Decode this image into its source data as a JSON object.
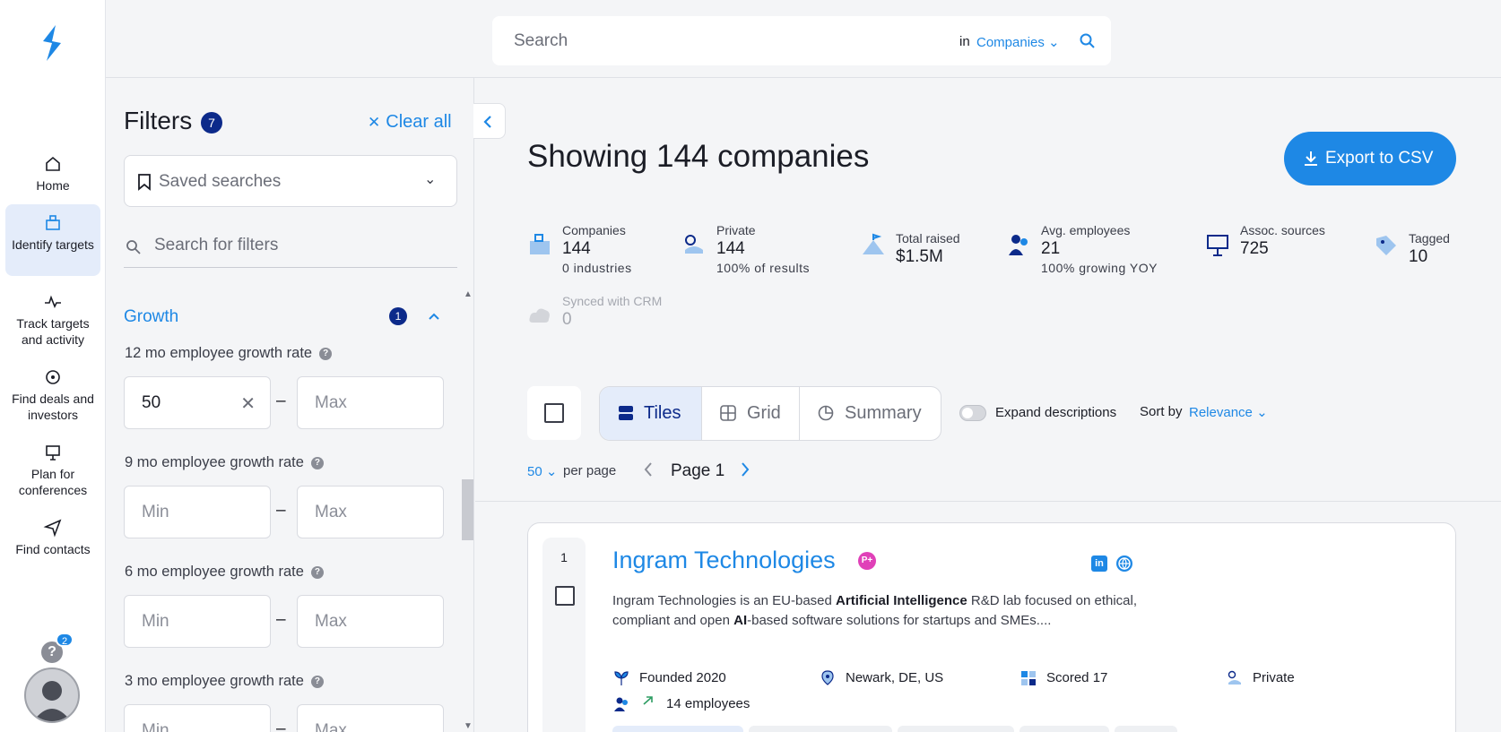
{
  "nav": {
    "items": [
      {
        "label": "Home"
      },
      {
        "label": "Identify targets"
      },
      {
        "label": "Track targets and activity"
      },
      {
        "label": "Find deals and investors"
      },
      {
        "label": "Plan for conferences"
      },
      {
        "label": "Find contacts"
      }
    ],
    "help_badge": "2",
    "help_glyph": "?"
  },
  "search": {
    "placeholder": "Search",
    "in_label": "in",
    "scope": "Companies"
  },
  "filters": {
    "title": "Filters",
    "count": "7",
    "clear_all": "Clear all",
    "saved_searches": "Saved searches",
    "search_placeholder": "Search for filters",
    "section": {
      "title": "Growth",
      "count": "1"
    },
    "rows": [
      {
        "label": "12 mo employee growth rate",
        "min": "50",
        "max_placeholder": "Max"
      },
      {
        "label": "9 mo employee growth rate",
        "min_placeholder": "Min",
        "max_placeholder": "Max"
      },
      {
        "label": "6 mo employee growth rate",
        "min_placeholder": "Min",
        "max_placeholder": "Max"
      },
      {
        "label": "3 mo employee growth rate",
        "min_placeholder": "Min",
        "max_placeholder": "Max"
      }
    ],
    "range_dash": "–",
    "clear_x": "✕"
  },
  "main": {
    "heading": "Showing 144 companies",
    "export": "Export to CSV",
    "stats": [
      {
        "label": "Companies",
        "value": "144",
        "sub": "0 industries"
      },
      {
        "label": "Private",
        "value": "144",
        "sub": "100% of results"
      },
      {
        "label": "Total raised",
        "value": "$1.5M"
      },
      {
        "label": "Avg. employees",
        "value": "21",
        "sub": "100% growing YOY"
      },
      {
        "label": "Assoc. sources",
        "value": "725"
      },
      {
        "label": "Tagged",
        "value": "10"
      },
      {
        "label": "Synced with CRM",
        "value": "0"
      }
    ],
    "tabs": [
      {
        "label": "Tiles"
      },
      {
        "label": "Grid"
      },
      {
        "label": "Summary"
      }
    ],
    "expand_descriptions": "Expand descriptions",
    "sort_label": "Sort by",
    "sort_value": "Relevance",
    "per_page_value": "50",
    "per_page_label": "per page",
    "page_label": "Page 1"
  },
  "result": {
    "rank": "1",
    "name": "Ingram Technologies",
    "badge": "P+",
    "linkedin": "in",
    "desc_parts": [
      "Ingram Technologies is an EU-based ",
      "Artificial Intelligence",
      " R&D lab focused on ethical, compliant and open ",
      "AI",
      "-based software solutions for startups and SMEs...."
    ],
    "founded": "Founded 2020",
    "location": "Newark, DE, US",
    "scored": "Scored 17",
    "ownership": "Private",
    "employees": "14 employees"
  },
  "colors": {
    "accent": "#1e88e5",
    "navy": "#0c2a8a",
    "badge_pink": "#e040b8"
  }
}
